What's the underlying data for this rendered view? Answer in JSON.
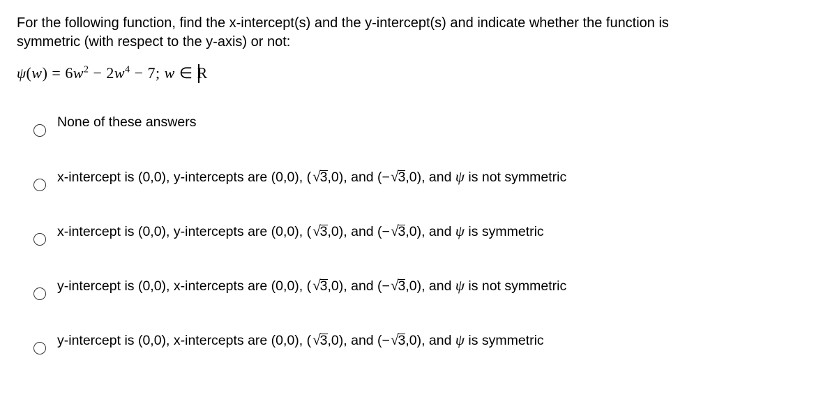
{
  "question": {
    "prompt_line1": "For the following function, find the x-intercept(s) and the y-intercept(s)  and indicate whether the function is",
    "prompt_line2": "symmetric (with respect to the y-axis) or not:",
    "formula": {
      "lhs_func": "ψ",
      "lhs_var": "w",
      "eq": " = ",
      "rhs": "6w² − 2w⁴ − 7; w ∈ ℝ"
    }
  },
  "options": [
    {
      "text": "None of these answers",
      "hasMath": false
    },
    {
      "prefix": "x-intercept is (0,0), y-intercepts are (0,0), (",
      "mid1": ",0), and (−",
      "mid2": ",0), and ",
      "suffix": " is not symmetric",
      "sqrtArg": "3",
      "psi": "ψ",
      "hasMath": true
    },
    {
      "prefix": "x-intercept is (0,0), y-intercepts are (0,0), (",
      "mid1": ",0), and (−",
      "mid2": ",0), and ",
      "suffix": " is symmetric",
      "sqrtArg": "3",
      "psi": "ψ",
      "hasMath": true
    },
    {
      "prefix": "y-intercept is (0,0), x-intercepts are (0,0), (",
      "mid1": ",0), and (−",
      "mid2": ",0), and ",
      "suffix": " is not symmetric",
      "sqrtArg": "3",
      "psi": "ψ",
      "hasMath": true
    },
    {
      "prefix": "y-intercept is (0,0), x-intercepts are (0,0), (",
      "mid1": ",0), and (−",
      "mid2": ",0), and ",
      "suffix": " is symmetric",
      "sqrtArg": "3",
      "psi": "ψ",
      "hasMath": true
    }
  ]
}
